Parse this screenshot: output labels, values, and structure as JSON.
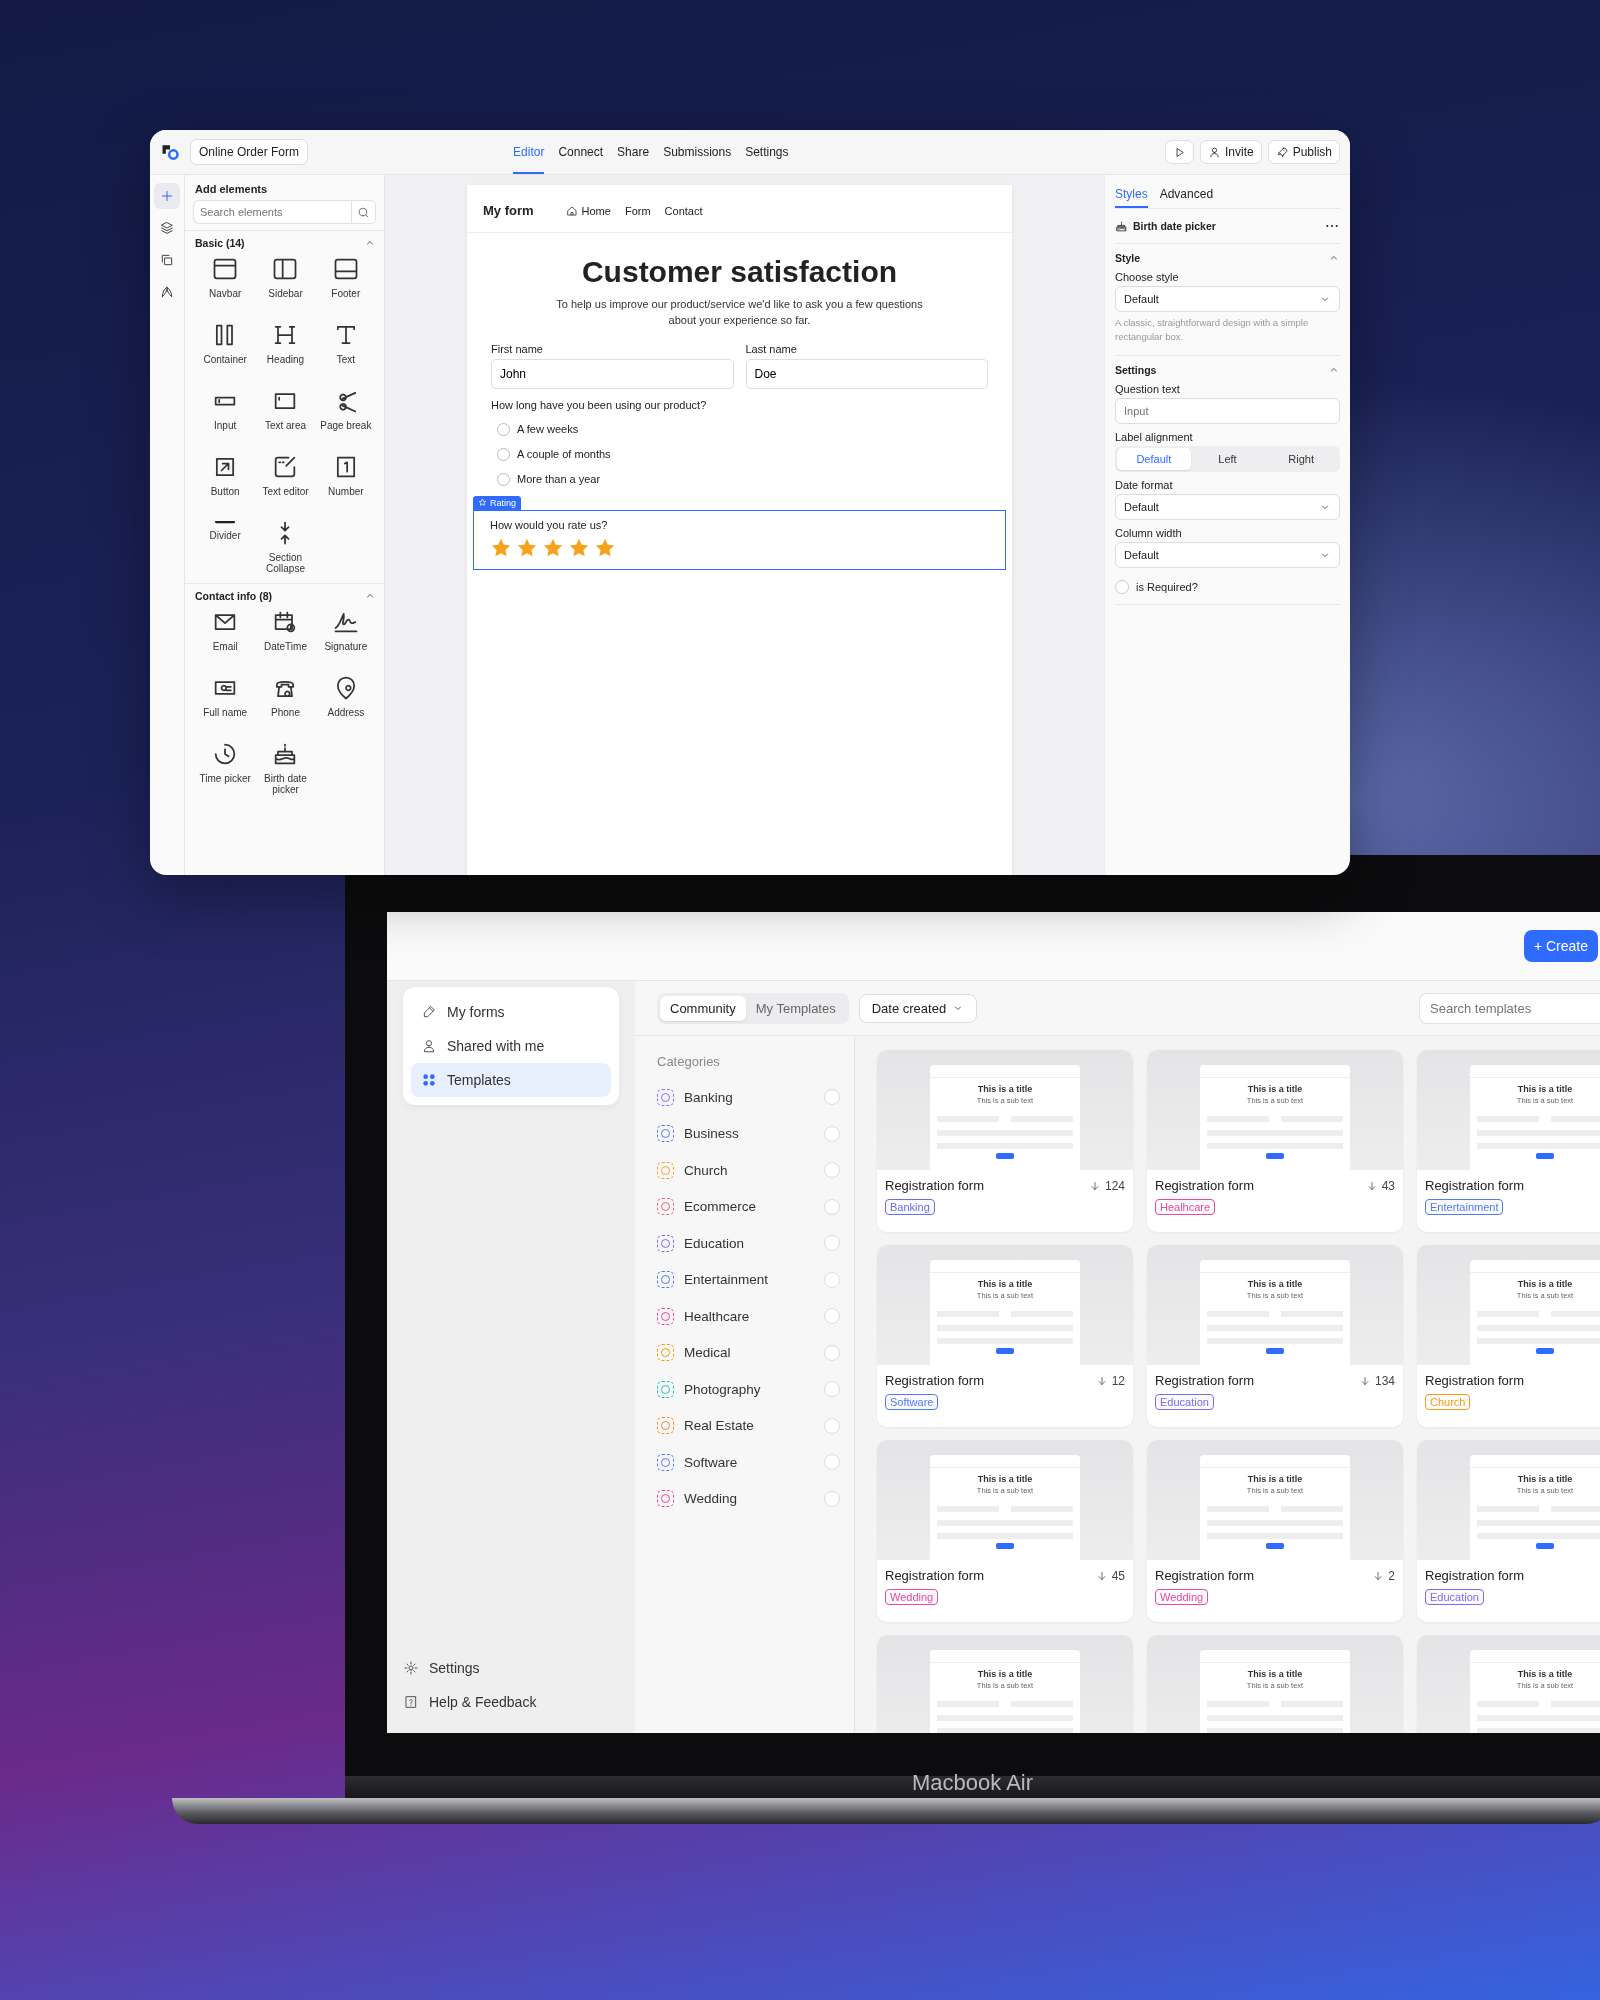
{
  "editor": {
    "form_name": "Online Order Form",
    "tabs": [
      {
        "label": "Editor",
        "selected": true
      },
      {
        "label": "Connect",
        "selected": false
      },
      {
        "label": "Share",
        "selected": false
      },
      {
        "label": "Submissions",
        "selected": false
      },
      {
        "label": "Settings",
        "selected": false
      }
    ],
    "actions": [
      {
        "kind": "play"
      },
      {
        "kind": "invite",
        "label": "Invite"
      },
      {
        "kind": "publish",
        "label": "Publish"
      }
    ],
    "rail": [
      {
        "kind": "plus",
        "selected": true
      },
      {
        "kind": "layers",
        "selected": false
      },
      {
        "kind": "copy",
        "selected": false
      },
      {
        "kind": "brush",
        "selected": false
      }
    ],
    "elements_panel": {
      "title": "Add elements",
      "search_placeholder": "Search elements",
      "groups": [
        {
          "title": "Basic (14)",
          "expanded": true,
          "items": [
            {
              "kind": "navbar",
              "label": "Navbar"
            },
            {
              "kind": "sidebar",
              "label": "Sidebar"
            },
            {
              "kind": "footer",
              "label": "Footer"
            },
            {
              "kind": "container",
              "label": "Container"
            },
            {
              "kind": "heading",
              "label": "Heading"
            },
            {
              "kind": "text",
              "label": "Text"
            },
            {
              "kind": "input",
              "label": "Input"
            },
            {
              "kind": "textarea",
              "label": "Text area"
            },
            {
              "kind": "pagebreak",
              "label": "Page break"
            },
            {
              "kind": "button",
              "label": "Button"
            },
            {
              "kind": "texteditor",
              "label": "Text editor"
            },
            {
              "kind": "number",
              "label": "Number"
            },
            {
              "kind": "divider",
              "label": "Divider"
            },
            {
              "kind": "collapse",
              "label": "Section Collapse"
            }
          ]
        },
        {
          "title": "Contact info (8)",
          "expanded": true,
          "items": [
            {
              "kind": "email",
              "label": "Email"
            },
            {
              "kind": "datetime",
              "label": "DateTime"
            },
            {
              "kind": "signature",
              "label": "Signature"
            },
            {
              "kind": "fullname",
              "label": "Full name"
            },
            {
              "kind": "phone",
              "label": "Phone"
            },
            {
              "kind": "address",
              "label": "Address"
            },
            {
              "kind": "timepicker",
              "label": "Time picker"
            },
            {
              "kind": "birthdate",
              "label": "Birth date picker"
            }
          ]
        }
      ]
    },
    "form": {
      "brand": "My form",
      "nav": [
        "Home",
        "Form",
        "Contact"
      ],
      "title": "Customer satisfaction",
      "subtitle": "To help us improve our product/service we'd like to ask you a few questions about your experience so far.",
      "fields": [
        {
          "label": "First name",
          "value": "John"
        },
        {
          "label": "Last name",
          "value": "Doe"
        }
      ],
      "question": "How long have you been using our product?",
      "options": [
        {
          "label": "A few weeks",
          "selected": false
        },
        {
          "label": "A couple of months",
          "selected": false
        },
        {
          "label": "More than a year",
          "selected": false
        }
      ],
      "rating": {
        "tag": "Rating",
        "question": "How would you rate us?",
        "stars": 5,
        "selected": true
      }
    },
    "inspector": {
      "tabs": [
        {
          "label": "Styles",
          "selected": true
        },
        {
          "label": "Advanced",
          "selected": false
        }
      ],
      "element": "Birth date picker",
      "style_section": {
        "title": "Style",
        "expanded": true,
        "label": "Choose style",
        "value": "Default",
        "hint": "A classic, straightforward design with a simple rectangular box."
      },
      "settings_section": {
        "title": "Settings",
        "expanded": true,
        "question_label": "Question text",
        "question_placeholder": "Input",
        "alignment_label": "Label alignment",
        "alignment": [
          {
            "label": "Default",
            "selected": true
          },
          {
            "label": "Left",
            "selected": false
          },
          {
            "label": "Right",
            "selected": false
          }
        ],
        "selects": [
          {
            "label": "Date format",
            "value": "Default"
          },
          {
            "label": "Column width",
            "value": "Default"
          }
        ],
        "required": {
          "label": "is Required?",
          "checked": false
        }
      }
    }
  },
  "app": {
    "create_button": "+ Create",
    "sidebar": {
      "items": [
        {
          "kind": "pencil",
          "label": "My forms",
          "selected": false
        },
        {
          "kind": "user",
          "label": "Shared with me",
          "selected": false
        },
        {
          "kind": "grid",
          "label": "Templates",
          "selected": true
        }
      ],
      "footer": [
        {
          "kind": "gear",
          "label": "Settings"
        },
        {
          "kind": "help",
          "label": "Help & Feedback"
        }
      ]
    },
    "source_tabs": [
      {
        "label": "Community",
        "selected": true
      },
      {
        "label": "My Templates",
        "selected": false
      }
    ],
    "sort": "Date created",
    "search_placeholder": "Search templates",
    "categories": {
      "title": "Categories",
      "items": [
        {
          "label": "Banking",
          "color": "#8b6cf6",
          "checked": false
        },
        {
          "label": "Business",
          "color": "#5b7cf0",
          "checked": false
        },
        {
          "label": "Church",
          "color": "#f5a524",
          "checked": false
        },
        {
          "label": "Ecommerce",
          "color": "#f0607a",
          "checked": false
        },
        {
          "label": "Education",
          "color": "#7b6cf0",
          "checked": false
        },
        {
          "label": "Entertainment",
          "color": "#4f7cf0",
          "checked": false
        },
        {
          "label": "Healthcare",
          "color": "#ec4899",
          "checked": false
        },
        {
          "label": "Medical",
          "color": "#f59e0b",
          "checked": false
        },
        {
          "label": "Photography",
          "color": "#22c3c9",
          "checked": false
        },
        {
          "label": "Real Estate",
          "color": "#f28c38",
          "checked": false
        },
        {
          "label": "Software",
          "color": "#5b7cf0",
          "checked": false
        },
        {
          "label": "Wedding",
          "color": "#ec4899",
          "checked": false
        }
      ]
    },
    "templates": [
      {
        "preview_title": "This is a title",
        "preview_subtitle": "This is a sub text",
        "name": "Registration form",
        "downloads": "124",
        "tag": "Banking",
        "color": "#6a6cf0"
      },
      {
        "preview_title": "This is a title",
        "preview_subtitle": "This is a sub text",
        "name": "Registration form",
        "downloads": "43",
        "tag": "Healhcare",
        "color": "#ec4899"
      },
      {
        "preview_title": "This is a title",
        "preview_subtitle": "This is a sub text",
        "name": "Registration form",
        "tag": "Entertainment",
        "color": "#4f7cf0"
      },
      {
        "preview_title": "This is a title",
        "preview_subtitle": "This is a sub text",
        "name": "Registration form",
        "downloads": "12",
        "tag": "Software",
        "color": "#4f7cf0"
      },
      {
        "preview_title": "This is a title",
        "preview_subtitle": "This is a sub text",
        "name": "Registration form",
        "downloads": "134",
        "tag": "Education",
        "color": "#7b6cf0"
      },
      {
        "preview_title": "This is a title",
        "preview_subtitle": "This is a sub text",
        "name": "Registration form",
        "tag": "Church",
        "color": "#f59e0b"
      },
      {
        "preview_title": "This is a title",
        "preview_subtitle": "This is a sub text",
        "name": "Registration form",
        "downloads": "45",
        "tag": "Wedding",
        "color": "#ec4899"
      },
      {
        "preview_title": "This is a title",
        "preview_subtitle": "This is a sub text",
        "name": "Registration form",
        "downloads": "2",
        "tag": "Wedding",
        "color": "#ec4899"
      },
      {
        "preview_title": "This is a title",
        "preview_subtitle": "This is a sub text",
        "name": "Registration form",
        "tag": "Education",
        "color": "#7b6cf0"
      },
      {
        "preview_title": "This is a title",
        "preview_subtitle": "This is a sub text"
      },
      {
        "preview_title": "This is a title",
        "preview_subtitle": "This is a sub text"
      },
      {
        "preview_title": "This is a title",
        "preview_subtitle": "This is a sub text"
      }
    ]
  },
  "device_label": "Macbook Air"
}
